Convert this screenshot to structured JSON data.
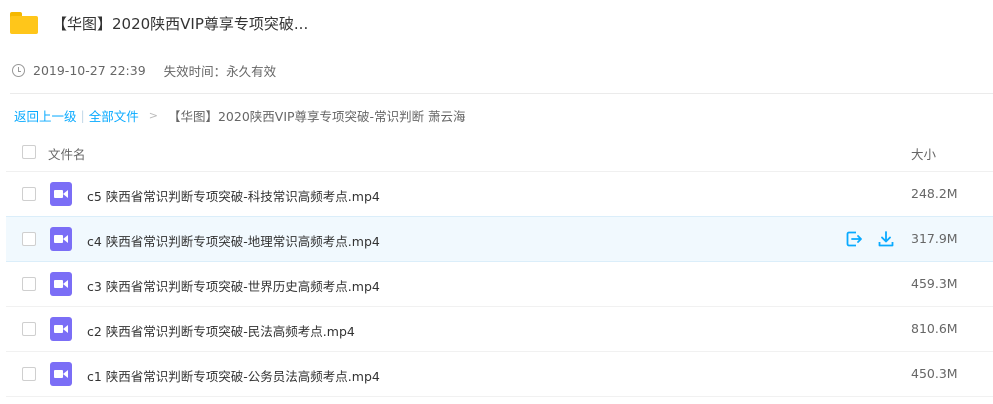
{
  "header": {
    "title": "【华图】2020陕西VIP尊享专项突破..."
  },
  "meta": {
    "date": "2019-10-27 22:39",
    "expiry": "失效时间：永久有效"
  },
  "breadcrumb": {
    "back": "返回上一级",
    "all_files": "全部文件",
    "separator": "|",
    "arrow": ">",
    "current": "【华图】2020陕西VIP尊享专项突破-常识判断 萧云海"
  },
  "table": {
    "col_name": "文件名",
    "col_size": "大小",
    "rows": [
      {
        "name": "c5 陕西省常识判断专项突破-科技常识高频考点.mp4",
        "size": "248.2M"
      },
      {
        "name": "c4 陕西省常识判断专项突破-地理常识高频考点.mp4",
        "size": "317.9M"
      },
      {
        "name": "c3 陕西省常识判断专项突破-世界历史高频考点.mp4",
        "size": "459.3M"
      },
      {
        "name": "c2 陕西省常识判断专项突破-民法高频考点.mp4",
        "size": "810.6M"
      },
      {
        "name": "c1 陕西省常识判断专项突破-公务员法高频考点.mp4",
        "size": "450.3M"
      }
    ]
  },
  "icons": {
    "folder": "folder-icon",
    "clock": "clock-icon",
    "video": "video-file-icon",
    "share": "share-icon",
    "download": "download-icon"
  },
  "colors": {
    "accent": "#09aaff",
    "video_icon": "#7b6ef6",
    "folder": "#ffc61a",
    "hover_row": "#f1f9fe"
  }
}
